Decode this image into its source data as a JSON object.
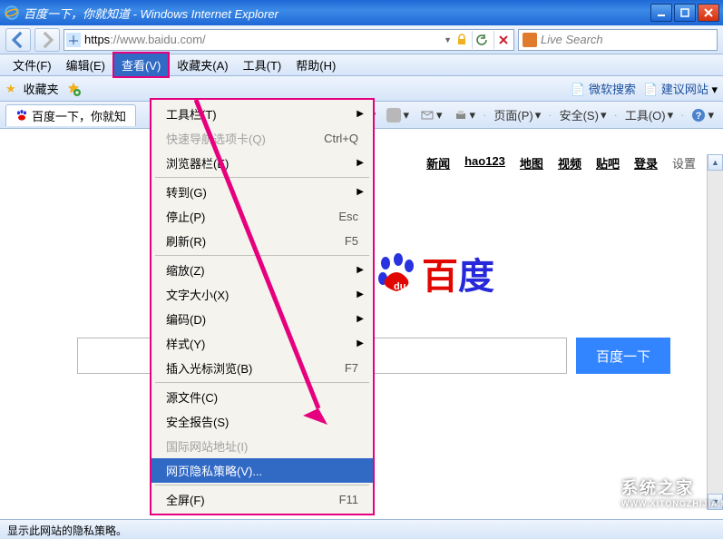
{
  "window": {
    "title": "百度一下，你就知道 - Windows Internet Explorer"
  },
  "address": {
    "proto": "https",
    "rest": "://www.baidu.com/"
  },
  "livesearch": {
    "placeholder": "Live Search"
  },
  "menubar": {
    "file": "文件(F)",
    "edit": "编辑(E)",
    "view": "查看(V)",
    "favorites": "收藏夹(A)",
    "tools": "工具(T)",
    "help": "帮助(H)"
  },
  "favbar": {
    "label": "收藏夹",
    "mssearch": "微软搜索",
    "suggest": "建议网站"
  },
  "tab": {
    "title": "百度一下，你就知"
  },
  "cmdbar": {
    "page": "页面(P)",
    "safety": "安全(S)",
    "tools": "工具(O)"
  },
  "viewmenu": {
    "toolbars": "工具栏(T)",
    "quicktabs": "快速导航选项卡(Q)",
    "quicktabs_sc": "Ctrl+Q",
    "explorerbar": "浏览器栏(E)",
    "goto": "转到(G)",
    "stop": "停止(P)",
    "stop_sc": "Esc",
    "refresh": "刷新(R)",
    "refresh_sc": "F5",
    "zoom": "缩放(Z)",
    "textsize": "文字大小(X)",
    "encoding": "编码(D)",
    "style": "样式(Y)",
    "caret": "插入光标浏览(B)",
    "caret_sc": "F7",
    "source": "源文件(C)",
    "security": "安全报告(S)",
    "intlsite": "国际网站地址(I)",
    "privacy": "网页隐私策略(V)...",
    "fullscreen": "全屏(F)",
    "fullscreen_sc": "F11"
  },
  "baidu": {
    "nav": {
      "news": "新闻",
      "hao123": "hao123",
      "map": "地图",
      "video": "视频",
      "tieba": "贴吧",
      "login": "登录",
      "settings": "设置"
    },
    "logo_bai": "百",
    "logo_du": "度",
    "search_btn": "百度一下"
  },
  "statusbar": {
    "text": "显示此网站的隐私策略。"
  },
  "watermark": {
    "big": "系统之家",
    "small": "WWW.XITONGZHIJIA.NET"
  }
}
